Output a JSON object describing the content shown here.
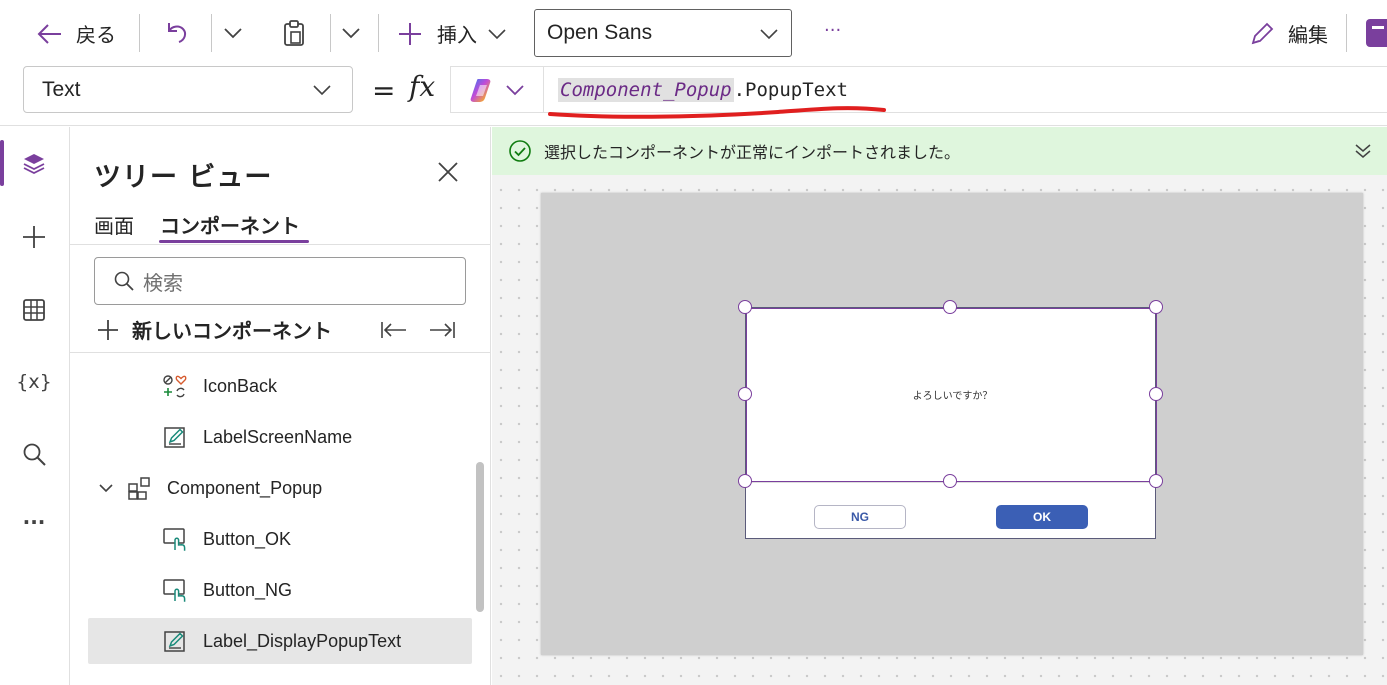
{
  "toolbar": {
    "back_label": "戻る",
    "insert_label": "挿入",
    "font_value": "Open Sans",
    "more_label": "···",
    "edit_label": "編集"
  },
  "formula_bar": {
    "property": "Text",
    "equals": "=",
    "fx": "fx",
    "formula_ref": "Component_Popup",
    "formula_rest": ".PopupText"
  },
  "rail": {
    "icons": [
      "layers-icon",
      "plus-icon",
      "table-icon",
      "variables-icon",
      "search-icon",
      "more-icon"
    ],
    "variables_glyph": "{x}",
    "more_glyph": "···",
    "accent": "#7a3f9d"
  },
  "tree": {
    "title": "ツリー ビュー",
    "tabs": [
      {
        "label": "画面",
        "active": false
      },
      {
        "label": "コンポーネント",
        "active": true
      }
    ],
    "search_placeholder": "検索",
    "new_component_label": "新しいコンポーネント",
    "items": [
      {
        "label": "IconBack",
        "icon": "icon-control-icon",
        "selected": false
      },
      {
        "label": "LabelScreenName",
        "icon": "label-edit-icon",
        "selected": false
      },
      {
        "label": "Component_Popup",
        "icon": "component-icon",
        "selected": false,
        "expanded": true
      },
      {
        "label": "Button_OK",
        "icon": "button-icon",
        "selected": false
      },
      {
        "label": "Button_NG",
        "icon": "button-icon",
        "selected": false
      },
      {
        "label": "Label_DisplayPopupText",
        "icon": "label-edit-icon",
        "selected": true
      }
    ]
  },
  "banner": {
    "message": "選択したコンポーネントが正常にインポートされました。",
    "color": "#dff6dd"
  },
  "canvas": {
    "popup_text": "よろしいですか？",
    "ng_label": "NG",
    "ok_label": "OK",
    "ok_color": "#3b5fb5"
  }
}
